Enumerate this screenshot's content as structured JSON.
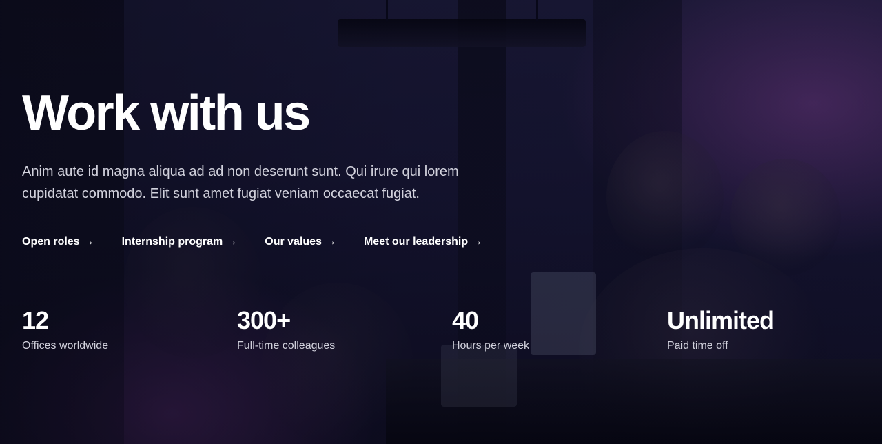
{
  "hero": {
    "title": "Work with us",
    "description": "Anim aute id magna aliqua ad ad non deserunt sunt. Qui irure qui lorem cupidatat commodo. Elit sunt amet fugiat veniam occaecat fugiat.",
    "links": [
      {
        "label": "Open roles",
        "icon": "arrow-right-icon"
      },
      {
        "label": "Internship program",
        "icon": "arrow-right-icon"
      },
      {
        "label": "Our values",
        "icon": "arrow-right-icon"
      },
      {
        "label": "Meet our leadership",
        "icon": "arrow-right-icon"
      }
    ],
    "stats": [
      {
        "value": "12",
        "label": "Offices worldwide"
      },
      {
        "value": "300+",
        "label": "Full-time colleagues"
      },
      {
        "value": "40",
        "label": "Hours per week"
      },
      {
        "value": "Unlimited",
        "label": "Paid time off"
      }
    ]
  },
  "colors": {
    "background": "#161533",
    "text": "#ffffff",
    "muted_text": "#d1d1dc",
    "glow": "#783c8c"
  }
}
